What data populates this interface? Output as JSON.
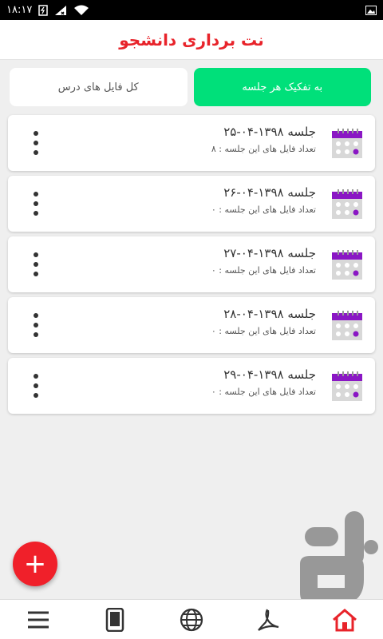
{
  "status_bar": {
    "time": "۱۸:۱۷"
  },
  "app_bar": {
    "title": "نت برداری دانشجو"
  },
  "tabs": [
    {
      "label": "کل فایل های درس",
      "active": false
    },
    {
      "label": "به تفکیک هر جلسه",
      "active": true
    }
  ],
  "sessions": [
    {
      "title": "جلسه ۱۳۹۸-۰۴-۲۵",
      "files": "تعداد فایل های این جلسه : ۸"
    },
    {
      "title": "جلسه ۱۳۹۸-۰۴-۲۶",
      "files": "تعداد فایل های این جلسه : ۰"
    },
    {
      "title": "جلسه ۱۳۹۸-۰۴-۲۷",
      "files": "تعداد فایل های این جلسه : ۰"
    },
    {
      "title": "جلسه ۱۳۹۸-۰۴-۲۸",
      "files": "تعداد فایل های این جلسه : ۰"
    },
    {
      "title": "جلسه ۱۳۹۸-۰۴-۲۹",
      "files": "تعداد فایل های این جلسه : ۰"
    }
  ],
  "fab": {
    "label": "+"
  },
  "bottom_nav": [
    {
      "icon": "menu-icon"
    },
    {
      "icon": "tablet-icon"
    },
    {
      "icon": "globe-icon"
    },
    {
      "icon": "pdf-icon"
    },
    {
      "icon": "home-icon",
      "active": true
    }
  ],
  "colors": {
    "accent": "#e8232a",
    "active_tab": "#00e07a",
    "fab": "#f0202a",
    "calendar_header": "#8a17c4"
  }
}
